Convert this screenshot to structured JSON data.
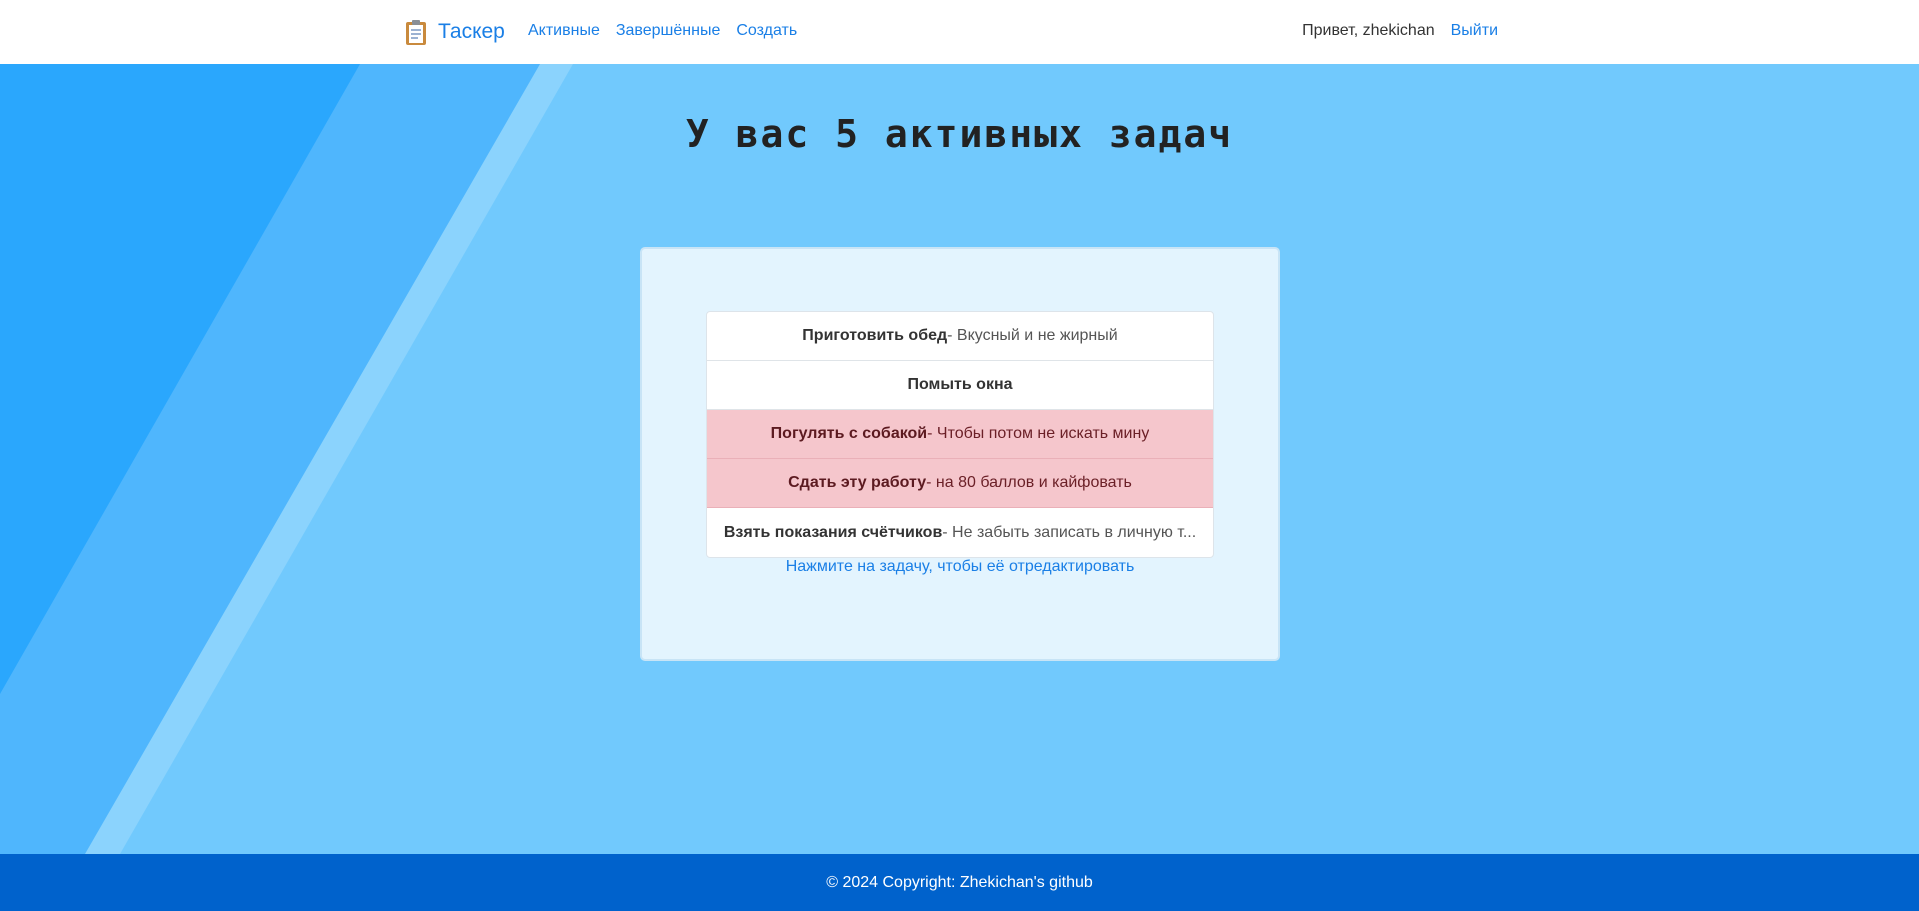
{
  "navbar": {
    "brand": "Таскер",
    "brand_icon": "clipboard-icon",
    "links": [
      "Активные",
      "Завершённые",
      "Создать"
    ],
    "greeting": "Привет, zhekichan",
    "logout": "Выйти"
  },
  "main": {
    "title": "У вас 5 активных задач",
    "tasks": [
      {
        "title": "Приготовить обед",
        "desc": " - Вкусный и не жирный",
        "status": "normal"
      },
      {
        "title": "Помыть окна",
        "desc": "",
        "status": "normal"
      },
      {
        "title": "Погулять с собакой",
        "desc": " - Чтобы потом не искать мину",
        "status": "danger"
      },
      {
        "title": "Сдать эту работу",
        "desc": " - на 80 баллов и кайфовать",
        "status": "danger"
      },
      {
        "title": "Взять показания счётчиков",
        "desc": " - Не забыть записать в личную т...",
        "status": "normal"
      }
    ],
    "hint": "Нажмите на задачу, чтобы её отредактировать"
  },
  "footer": {
    "text": "© 2024 Copyright: Zhekichan's github"
  },
  "colors": {
    "accent": "#1a7fe6",
    "hero_bg": "#71c9fd",
    "footer_bg": "#0062cc",
    "danger_row": "#f5c6cc"
  }
}
